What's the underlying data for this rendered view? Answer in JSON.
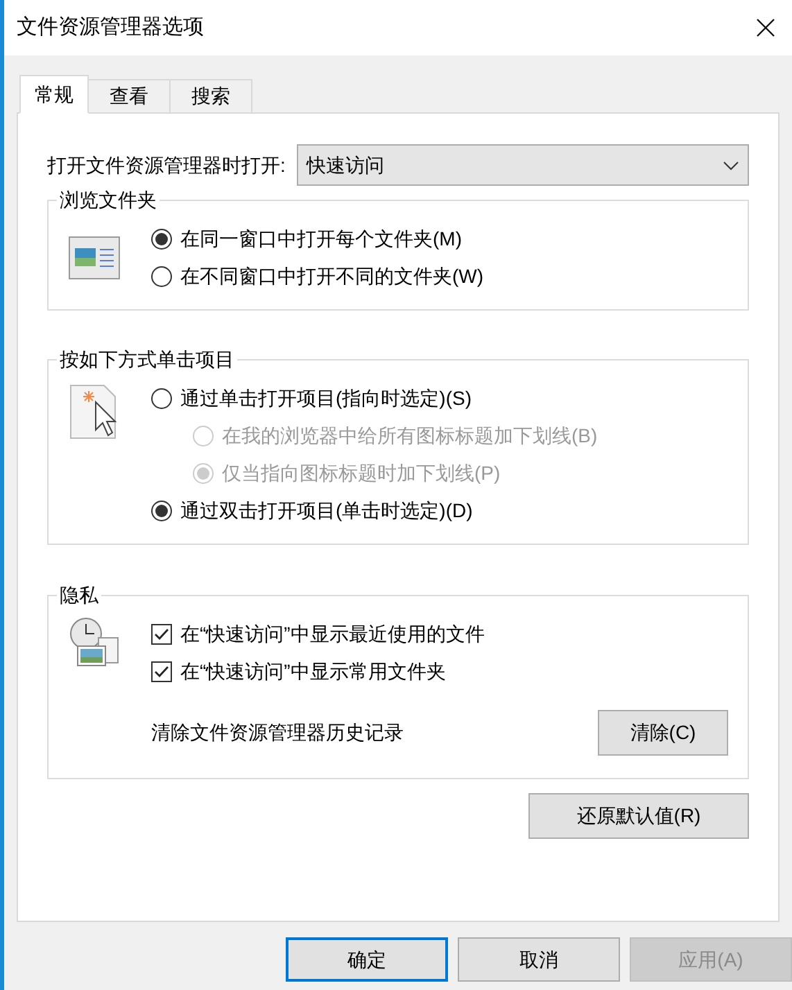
{
  "window": {
    "title": "文件资源管理器选项"
  },
  "tabs": [
    {
      "label": "常规",
      "selected": true
    },
    {
      "label": "查看",
      "selected": false
    },
    {
      "label": "搜索",
      "selected": false
    }
  ],
  "open_with": {
    "label": "打开文件资源管理器时打开:",
    "value": "快速访问"
  },
  "browse_folders": {
    "title": "浏览文件夹",
    "options": [
      {
        "label": "在同一窗口中打开每个文件夹(M)",
        "selected": true,
        "disabled": false,
        "indented": false
      },
      {
        "label": "在不同窗口中打开不同的文件夹(W)",
        "selected": false,
        "disabled": false,
        "indented": false
      }
    ]
  },
  "click_items": {
    "title": "按如下方式单击项目",
    "options": [
      {
        "label": "通过单击打开项目(指向时选定)(S)",
        "selected": false,
        "disabled": false,
        "indented": false
      },
      {
        "label": "在我的浏览器中给所有图标标题加下划线(B)",
        "selected": false,
        "disabled": true,
        "indented": true
      },
      {
        "label": "仅当指向图标标题时加下划线(P)",
        "selected": true,
        "disabled": true,
        "indented": true
      },
      {
        "label": "通过双击打开项目(单击时选定)(D)",
        "selected": true,
        "disabled": false,
        "indented": false
      }
    ]
  },
  "privacy": {
    "title": "隐私",
    "checkboxes": [
      {
        "label": "在“快速访问”中显示最近使用的文件",
        "checked": true
      },
      {
        "label": "在“快速访问”中显示常用文件夹",
        "checked": true
      }
    ],
    "clear_label": "清除文件资源管理器历史记录",
    "clear_button": "清除(C)"
  },
  "restore_button": "还原默认值(R)",
  "buttons": [
    {
      "label": "确定",
      "kind": "default",
      "disabled": false
    },
    {
      "label": "取消",
      "kind": "normal",
      "disabled": false
    },
    {
      "label": "应用(A)",
      "kind": "normal",
      "disabled": true
    }
  ]
}
